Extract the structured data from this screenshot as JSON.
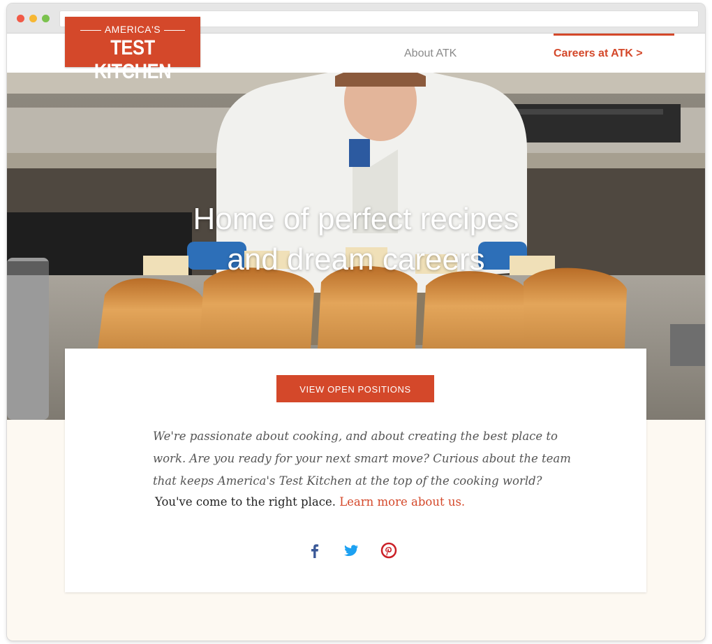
{
  "brand": {
    "line1": "AMERICA'S",
    "line2": "TEST KITCHEN",
    "color": "#d4482a"
  },
  "nav": {
    "items": [
      {
        "label": "About ATK",
        "active": false
      },
      {
        "label": "Careers at ATK >",
        "active": true
      }
    ]
  },
  "hero": {
    "title_line1": "Home of perfect recipes",
    "title_line2": "and dream careers",
    "image": "chef-with-bread-loaves"
  },
  "card": {
    "cta_label": "VIEW OPEN POSITIONS",
    "intro": "We're passionate about cooking, and about creating the best place to work. Are you ready for your next smart move?  Curious about the team that keeps America's Test Kitchen at the top of the cooking world?",
    "closing_text": "You've come to the right place.",
    "closing_link": "Learn more about us."
  },
  "social": [
    {
      "icon": "facebook-icon",
      "color": "#3b5998"
    },
    {
      "icon": "twitter-icon",
      "color": "#1da1f2"
    },
    {
      "icon": "pinterest-icon",
      "color": "#cb2027"
    }
  ]
}
